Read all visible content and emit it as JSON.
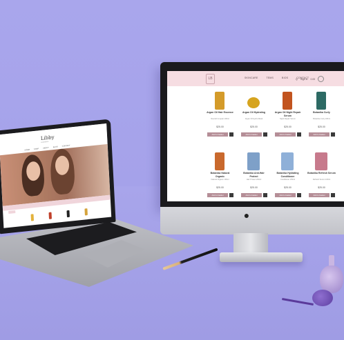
{
  "imac_site": {
    "logo": "LB",
    "nav": [
      "SKINCARE",
      "TEMS",
      "BIOS",
      "CONTACT"
    ],
    "tools": [
      "Q",
      "Sign in",
      "0.00"
    ],
    "products": [
      {
        "name": "Argan Oil Hair Essence",
        "desc": "Nourish & repair 100ml",
        "price": "$25.00",
        "add": "Add to basket",
        "color": "#d49b2a"
      },
      {
        "name": "Argan Oil Hydrating",
        "desc": "Argan Oil Hydro Mask",
        "price": "$25.00",
        "add": "Add to basket",
        "color": "#d6a41f"
      },
      {
        "name": "Argan Oil Night Repair Serum",
        "desc": "Night Repair Serum",
        "price": "$25.00",
        "add": "Add to basket",
        "color": "#c2541f"
      },
      {
        "name": "Botanika Curly",
        "desc": "Botanika Curly 100ml",
        "price": "$25.00",
        "add": "Add to basket",
        "color": "#2d6a64"
      },
      {
        "name": "Botanika Natural Organic",
        "desc": "Natural Organic 100ml",
        "price": "$25.00",
        "add": "Add to basket",
        "color": "#c9692d"
      },
      {
        "name": "Botanika Anti-Hair Protect",
        "desc": "Hair Protect 200ml",
        "price": "$25.00",
        "add": "Add to basket",
        "color": "#7ea0c8"
      },
      {
        "name": "Botanika Hydrating Conditioner",
        "desc": "Conditioner 250ml",
        "price": "$25.00",
        "add": "Add to basket",
        "color": "#8fb0d8"
      },
      {
        "name": "Botanika Refresh Serum",
        "desc": "Refresh Serum 100ml",
        "price": "$25.00",
        "add": "Add to basket",
        "color": "#c77a8c"
      }
    ]
  },
  "macbook_site": {
    "logo": "Libby",
    "logo_sub": "cosmetics",
    "nav": [
      "HOME",
      "SHOP",
      "ABOUT",
      "BLOG",
      "CONTACT"
    ],
    "product_colors": [
      "#e3b23c",
      "#c0402b",
      "#222222",
      "#d5a33b"
    ]
  },
  "icons": {
    "apple": "apple-logo-icon",
    "cart": "cart-icon",
    "search": "search-icon"
  }
}
